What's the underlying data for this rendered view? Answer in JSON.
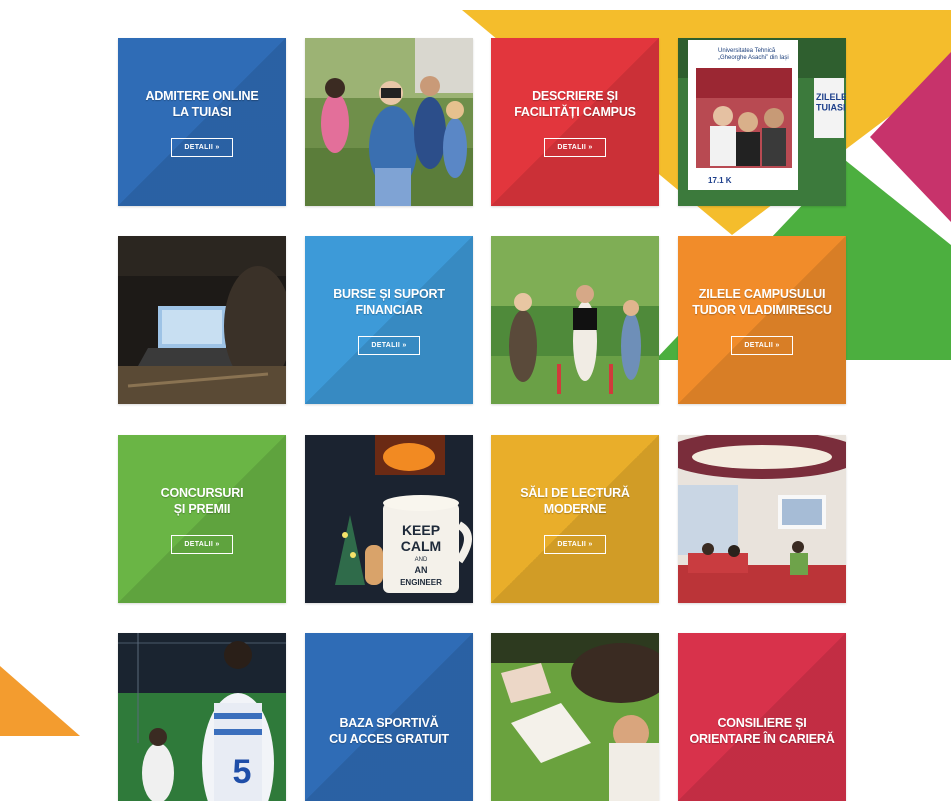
{
  "colors": {
    "blue": "#2f6cb6",
    "light_blue": "#3d9ad8",
    "red": "#e2363d",
    "orange": "#f18c2a",
    "green": "#6ab545",
    "yellow": "#e9ae2a",
    "crimson": "#d8324b",
    "deco_yellow": "#f4bd2c",
    "deco_green": "#4caf3f",
    "deco_pink": "#c7336b"
  },
  "tiles": {
    "admitere": {
      "title": "ADMITERE ONLINE\nLA TUIASI",
      "button": "DETALII »"
    },
    "campus": {
      "title": "DESCRIERE ȘI\nFACILITĂȚI CAMPUS",
      "button": "DETALII »"
    },
    "burse": {
      "title": "BURSE ȘI SUPORT\nFINANCIAR",
      "button": "DETALII »"
    },
    "zilele": {
      "title": "ZILELE CAMPUSULUI\nTUDOR VLADIMIRESCU",
      "button": "DETALII »"
    },
    "concurs": {
      "title": "CONCURSURI\nȘI PREMII",
      "button": "DETALII »"
    },
    "sali": {
      "title": "SĂLI DE LECTURĂ\nMODERNE",
      "button": "DETALII »"
    },
    "baza": {
      "title": "BAZA SPORTIVĂ\nCU ACCES GRATUIT"
    },
    "consiliere": {
      "title": "CONSILIERE ȘI\nORIENTARE ÎN CARIERĂ"
    }
  },
  "photos": {
    "frame": {
      "header": "Universitatea Tehnică\n„Gheorghe Asachi” din Iași",
      "banner": "ZILELE\nTUIASI",
      "likes": "17.1 K"
    },
    "mug": {
      "line1": "KEEP",
      "line2": "CALM",
      "line3": "AND",
      "line4": "AN",
      "line5": "ENGINEER"
    },
    "football": {
      "jersey_number": "5"
    }
  }
}
